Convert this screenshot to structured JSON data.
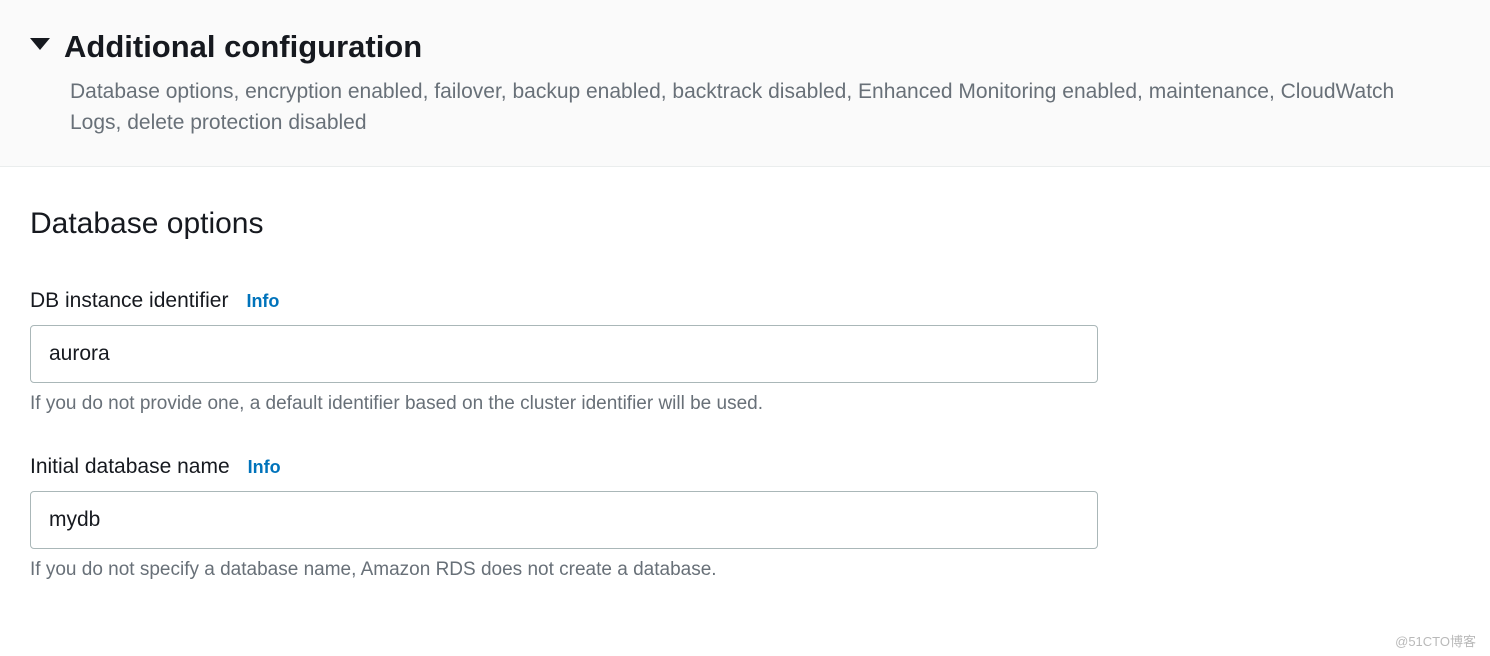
{
  "header": {
    "title": "Additional configuration",
    "summary": "Database options, encryption enabled, failover, backup enabled, backtrack disabled, Enhanced Monitoring enabled, maintenance, CloudWatch Logs, delete protection disabled"
  },
  "section": {
    "heading": "Database options"
  },
  "fields": {
    "dbInstanceIdentifier": {
      "label": "DB instance identifier",
      "infoLabel": "Info",
      "value": "aurora",
      "hint": "If you do not provide one, a default identifier based on the cluster identifier will be used."
    },
    "initialDatabaseName": {
      "label": "Initial database name",
      "infoLabel": "Info",
      "value": "mydb",
      "hint": "If you do not specify a database name, Amazon RDS does not create a database."
    }
  },
  "watermark": "@51CTO博客"
}
